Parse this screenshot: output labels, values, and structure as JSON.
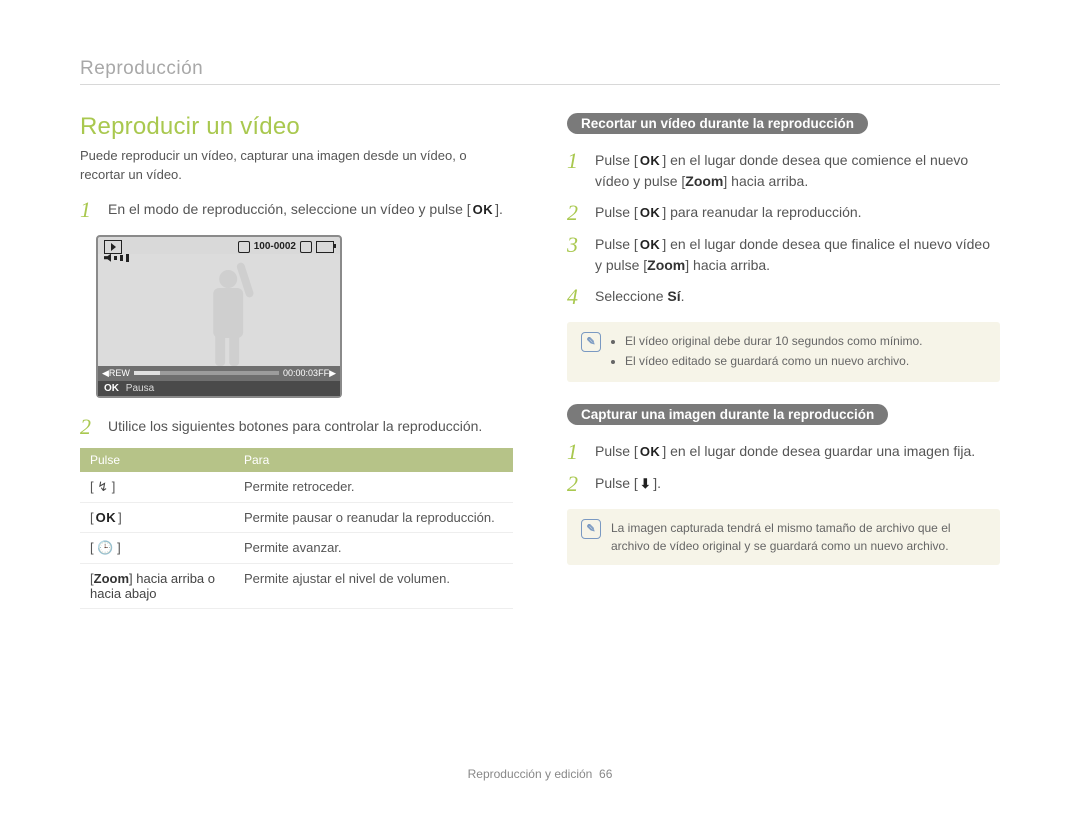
{
  "header": {
    "section": "Reproducción"
  },
  "title": "Reproducir un vídeo",
  "intro": "Puede reproducir un vídeo, capturar una imagen desde un vídeo, o recortar un vídeo.",
  "left_steps": {
    "s1": {
      "pre": "En el modo de reproducción, seleccione un vídeo y pulse [",
      "btn": "OK",
      "post": "]."
    },
    "s2": "Utilice los siguientes botones para controlar la reproducción."
  },
  "camera": {
    "counter": "100-0002",
    "time": "00:00:03",
    "rew": "REW",
    "ff": "FF",
    "ok": "OK",
    "footer": "Pausa"
  },
  "table": {
    "headers": [
      "Pulse",
      "Para"
    ],
    "rows": [
      {
        "press": "[ ↯ ]",
        "for": "Permite retroceder."
      },
      {
        "press": "[ OK ]",
        "for": "Permite pausar o reanudar la reproducción."
      },
      {
        "press": "[ 🕒 ]",
        "for": "Permite avanzar."
      },
      {
        "press_pre": "[",
        "press_bold": "Zoom",
        "press_post": "] hacia arriba o hacia abajo",
        "for": "Permite ajustar el nivel de volumen."
      }
    ]
  },
  "right": {
    "box1": {
      "title": "Recortar un vídeo durante la reproducción",
      "s1": {
        "pre": "Pulse [",
        "btn": "OK",
        "post": "] en el lugar donde desea que comience el nuevo vídeo y pulse [",
        "bold": "Zoom",
        "tail": "] hacia arriba."
      },
      "s2": {
        "pre": "Pulse [",
        "btn": "OK",
        "post": "] para reanudar la reproducción."
      },
      "s3": {
        "pre": "Pulse [",
        "btn": "OK",
        "post": "] en el lugar donde desea que finalice el nuevo vídeo y pulse [",
        "bold": "Zoom",
        "tail": "] hacia arriba."
      },
      "s4": {
        "pre": "Seleccione ",
        "bold": "Sí",
        "post": "."
      },
      "note": [
        "El vídeo original debe durar 10 segundos como mínimo.",
        "El vídeo editado se guardará como un nuevo archivo."
      ]
    },
    "box2": {
      "title": "Capturar una imagen durante la reproducción",
      "s1": {
        "pre": "Pulse [",
        "btn": "OK",
        "post": "] en el lugar donde desea guardar una imagen fija."
      },
      "s2": {
        "pre": "Pulse [",
        "icon": "⬇",
        "post": "]."
      },
      "note": "La imagen capturada tendrá el mismo tamaño de archivo que el archivo de vídeo original y se guardará como un nuevo archivo."
    }
  },
  "footer": {
    "label": "Reproducción y edición",
    "page": "66"
  },
  "chart_data": {
    "type": "table",
    "title": "Controles de reproducción de vídeo",
    "columns": [
      "Pulse",
      "Para"
    ],
    "rows": [
      [
        "[↯]",
        "Permite retroceder."
      ],
      [
        "[OK]",
        "Permite pausar o reanudar la reproducción."
      ],
      [
        "[🕒]",
        "Permite avanzar."
      ],
      [
        "[Zoom] hacia arriba o hacia abajo",
        "Permite ajustar el nivel de volumen."
      ]
    ]
  }
}
